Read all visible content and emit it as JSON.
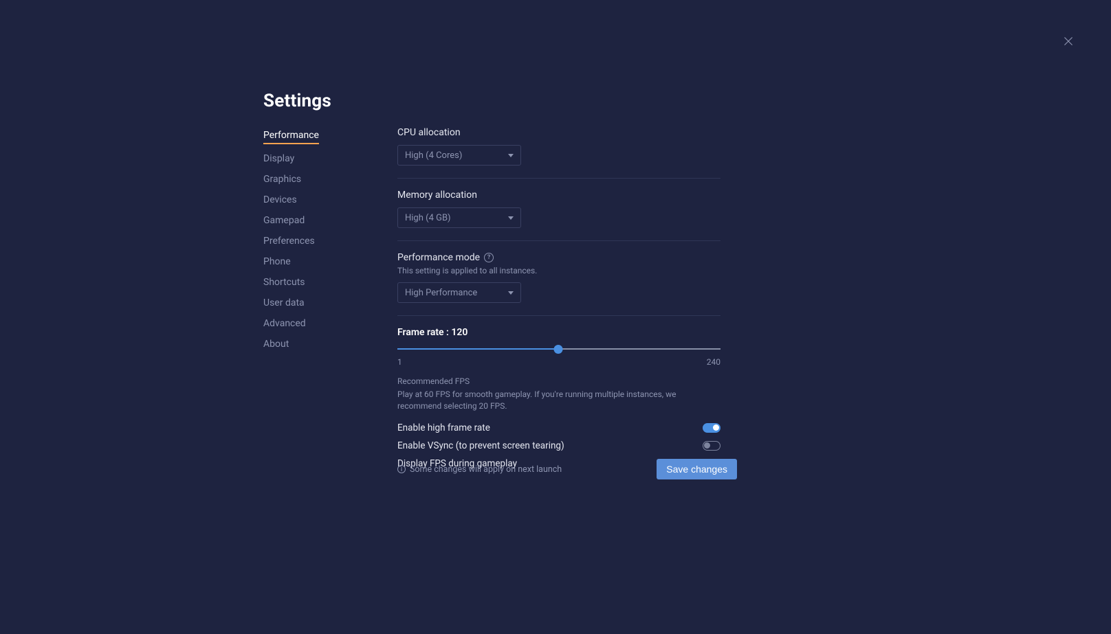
{
  "page_title": "Settings",
  "sidebar": {
    "items": [
      {
        "label": "Performance",
        "active": true
      },
      {
        "label": "Display",
        "active": false
      },
      {
        "label": "Graphics",
        "active": false
      },
      {
        "label": "Devices",
        "active": false
      },
      {
        "label": "Gamepad",
        "active": false
      },
      {
        "label": "Preferences",
        "active": false
      },
      {
        "label": "Phone",
        "active": false
      },
      {
        "label": "Shortcuts",
        "active": false
      },
      {
        "label": "User data",
        "active": false
      },
      {
        "label": "Advanced",
        "active": false
      },
      {
        "label": "About",
        "active": false
      }
    ]
  },
  "cpu": {
    "label": "CPU allocation",
    "value": "High (4 Cores)"
  },
  "memory": {
    "label": "Memory allocation",
    "value": "High (4 GB)"
  },
  "perf_mode": {
    "label": "Performance mode",
    "subtext": "This setting is applied to all instances.",
    "value": "High Performance"
  },
  "frame_rate": {
    "label_prefix": "Frame rate : ",
    "value": "120",
    "min": "1",
    "max": "240",
    "rec_title": "Recommended FPS",
    "rec_body": "Play at 60 FPS for smooth gameplay. If you're running multiple instances, we recommend selecting 20 FPS."
  },
  "toggles": {
    "high_frame": {
      "label": "Enable high frame rate",
      "on": true
    },
    "vsync": {
      "label": "Enable VSync (to prevent screen tearing)",
      "on": false
    },
    "display_fps": {
      "label": "Display FPS during gameplay",
      "on": false
    }
  },
  "footer": {
    "note": "Some changes will apply on next launch",
    "save": "Save changes"
  }
}
